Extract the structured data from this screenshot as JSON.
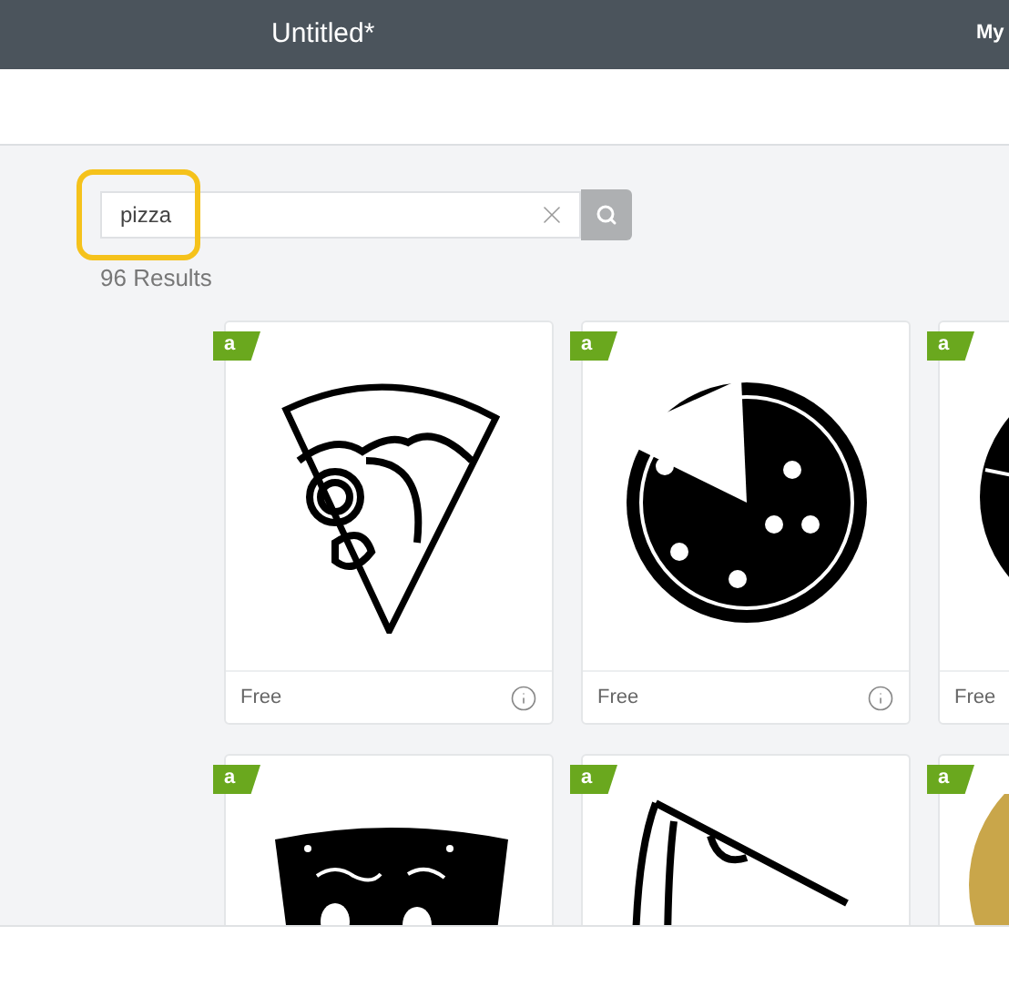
{
  "window": {
    "title": "Untitled*",
    "account": "My"
  },
  "search": {
    "value": "pizza",
    "highlighted": true
  },
  "results_count": "96 Results",
  "cards": [
    {
      "kind": "outline-slice",
      "badge": "a",
      "price": "Free",
      "info": true
    },
    {
      "kind": "pie",
      "badge": "a",
      "price": "Free",
      "info": true
    },
    {
      "kind": "dark-round",
      "badge": "a",
      "price": "Free"
    },
    {
      "kind": "face-slice",
      "badge": "a"
    },
    {
      "kind": "tilted-slice",
      "badge": "a"
    },
    {
      "kind": "gold-pie",
      "badge": "a"
    }
  ]
}
